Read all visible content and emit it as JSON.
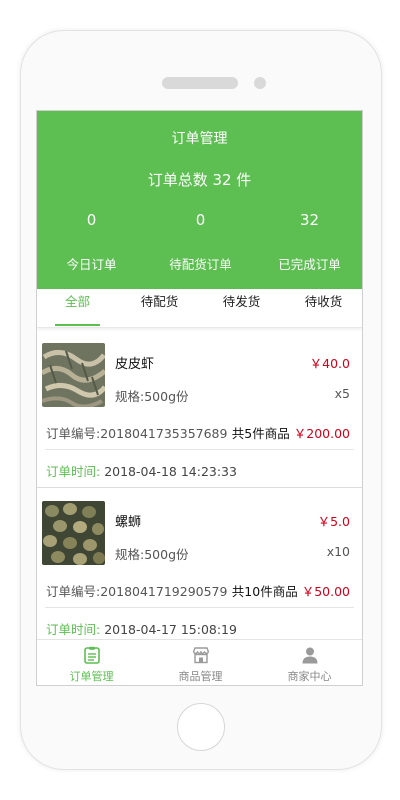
{
  "header": {
    "title": "订单管理",
    "total": "订单总数 32 件",
    "stats": [
      {
        "value": "0",
        "label": "今日订单"
      },
      {
        "value": "0",
        "label": "待配货订单"
      },
      {
        "value": "32",
        "label": "已完成订单"
      }
    ]
  },
  "tabs": [
    "全部",
    "待配货",
    "待发货",
    "待收货"
  ],
  "active_tab": "全部",
  "orders": [
    {
      "product_name": "皮皮虾",
      "price": "￥40.0",
      "spec": "规格:500g份",
      "qty": "x5",
      "order_no": "订单编号:2018041735357689",
      "summary_count": "共5件商品",
      "summary_amount": "￥200.00",
      "time_label": "订单时间:",
      "time_value": "2018-04-18 14:23:33",
      "thumb_icon": "shrimp-photo"
    },
    {
      "product_name": "螺蛳",
      "price": "￥5.0",
      "spec": "规格:500g份",
      "qty": "x10",
      "order_no": "订单编号:2018041719290579",
      "summary_count": "共10件商品",
      "summary_amount": "￥50.00",
      "time_label": "订单时间:",
      "time_value": "2018-04-17 15:08:19",
      "thumb_icon": "snail-photo"
    }
  ],
  "bottom_nav": [
    {
      "label": "订单管理",
      "icon": "order-list-icon"
    },
    {
      "label": "商品管理",
      "icon": "store-icon"
    },
    {
      "label": "商家中心",
      "icon": "user-icon"
    }
  ],
  "colors": {
    "accent": "#5dbe52",
    "price": "#d0021b"
  }
}
